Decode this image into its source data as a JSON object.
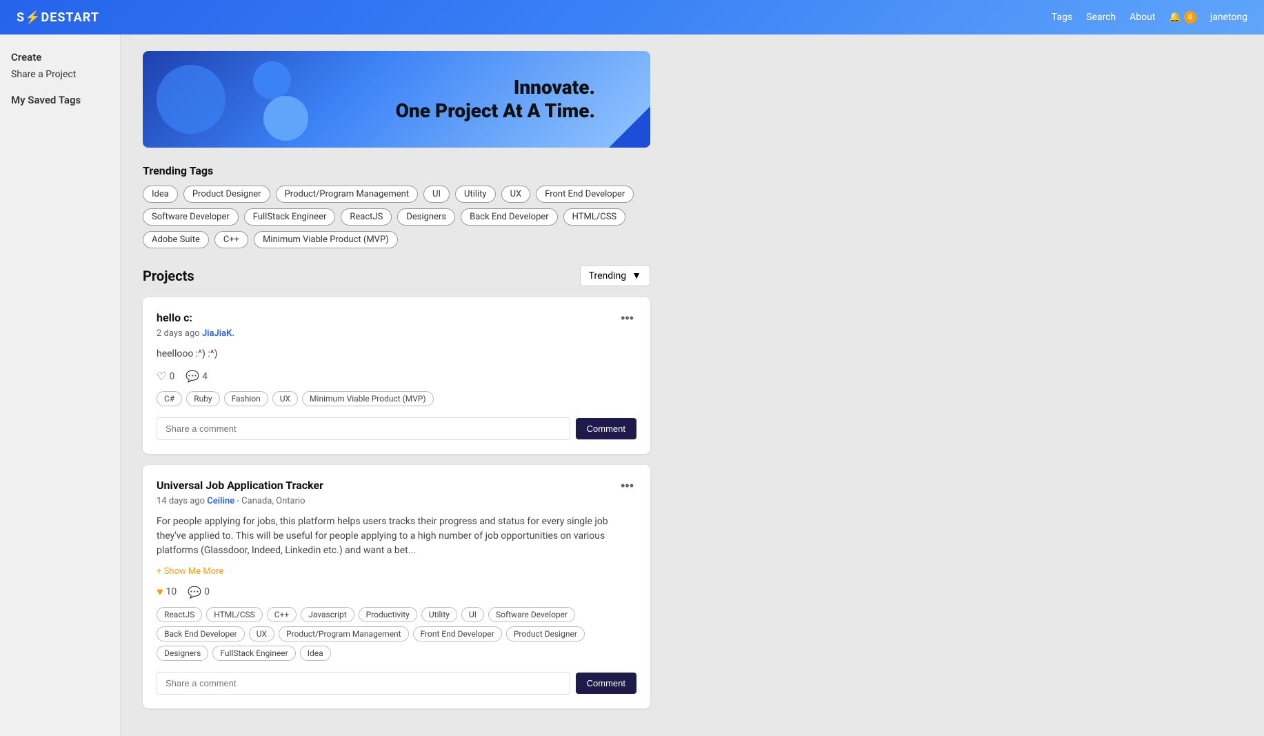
{
  "header": {
    "logo": "S⚡DESTART",
    "logo_lightning": "⚡",
    "nav": {
      "tags_label": "Tags",
      "search_label": "Search",
      "about_label": "About",
      "notif_count": "0",
      "username": "janetong"
    }
  },
  "sidebar": {
    "create_label": "Create",
    "share_project_label": "Share a Project",
    "my_saved_tags_label": "My Saved Tags"
  },
  "banner": {
    "line1": "Innovate.",
    "line2": "One Project At A Time."
  },
  "trending": {
    "title": "Trending Tags",
    "tags": [
      "Idea",
      "Product Designer",
      "Product/Program Management",
      "UI",
      "Utility",
      "UX",
      "Front End Developer",
      "Software Developer",
      "FullStack Engineer",
      "ReactJS",
      "Designers",
      "Back End Developer",
      "HTML/CSS",
      "Adobe Suite",
      "C++",
      "Minimum Viable Product (MVP)"
    ]
  },
  "projects": {
    "title": "Projects",
    "sort_label": "Trending",
    "sort_icon": "▼",
    "items": [
      {
        "id": "project-1",
        "title": "hello c:",
        "time_ago": "2 days ago",
        "author": "JiaJiaK.",
        "location": "",
        "description": "heellooo :^) :^)",
        "show_more": false,
        "likes": "0",
        "comments": "4",
        "heart_filled": false,
        "tags": [
          "C#",
          "Ruby",
          "Fashion",
          "UX",
          "Minimum Viable Product (MVP)"
        ],
        "comment_placeholder": "Share a comment",
        "comment_btn": "Comment"
      },
      {
        "id": "project-2",
        "title": "Universal Job Application Tracker",
        "time_ago": "14 days ago",
        "author": "Ceiline",
        "location": " - Canada, Ontario",
        "description": "For people applying for jobs, this platform helps users tracks their progress and status for every single job they've applied to. This will be useful for people applying to a high number of job opportunities on various platforms (Glassdoor, Indeed, Linkedin etc.) and want a bet...",
        "show_more": true,
        "show_more_label": "+ Show Me More",
        "likes": "10",
        "comments": "0",
        "heart_filled": true,
        "tags": [
          "ReactJS",
          "HTML/CSS",
          "C++",
          "Javascript",
          "Productivity",
          "Utility",
          "UI",
          "Software Developer",
          "Back End Developer",
          "UX",
          "Product/Program Management",
          "Front End Developer",
          "Product Designer",
          "Designers",
          "FullStack Engineer",
          "Idea"
        ],
        "comment_placeholder": "Share a comment",
        "comment_btn": "Comment"
      }
    ]
  }
}
